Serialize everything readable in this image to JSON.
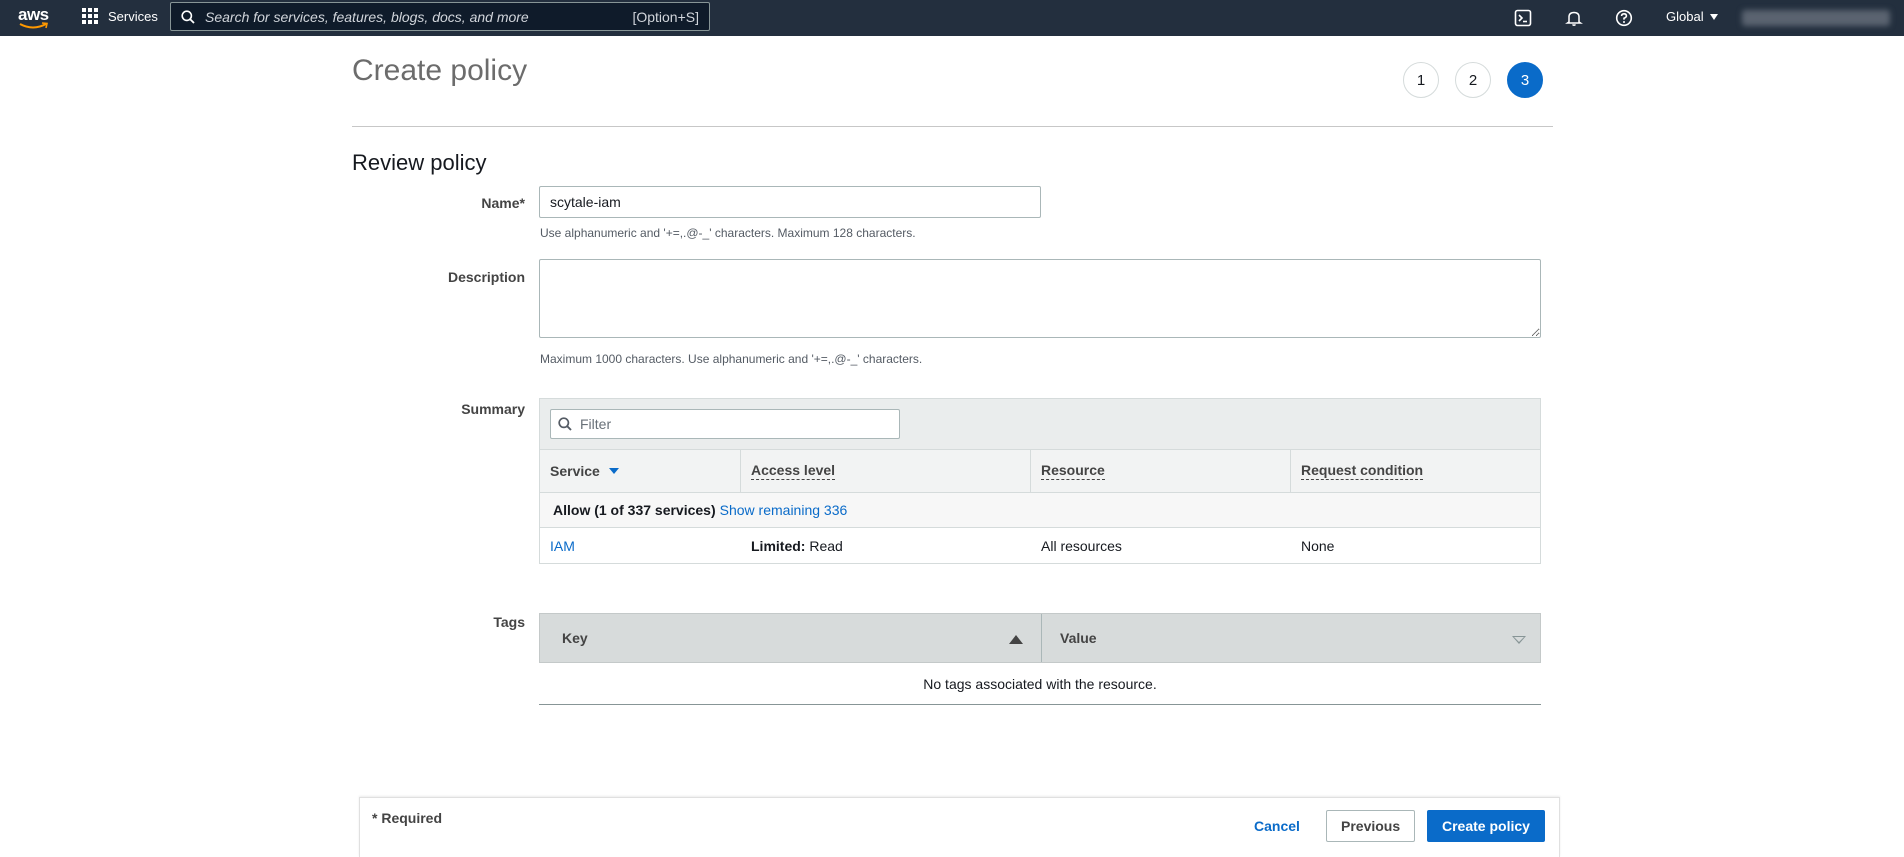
{
  "nav": {
    "logo": "aws",
    "services_label": "Services",
    "search_placeholder": "Search for services, features, blogs, docs, and more",
    "search_shortcut": "[Option+S]",
    "region": "Global",
    "icons": [
      "cloudshell-icon",
      "bell-icon",
      "help-icon"
    ]
  },
  "page": {
    "title": "Create policy",
    "steps": [
      "1",
      "2",
      "3"
    ],
    "active_step": "3",
    "section_title": "Review policy"
  },
  "form": {
    "name_label": "Name*",
    "name_value": "scytale-iam",
    "name_hint": "Use alphanumeric and '+=,.@-_' characters. Maximum 128 characters.",
    "description_label": "Description",
    "description_value": "",
    "description_hint": "Maximum 1000 characters. Use alphanumeric and '+=,.@-_' characters.",
    "summary_label": "Summary",
    "tags_label": "Tags"
  },
  "summary": {
    "filter_placeholder": "Filter",
    "columns": [
      "Service",
      "Access level",
      "Resource",
      "Request condition"
    ],
    "group_label": "Allow (1 of 337 services)",
    "group_link": "Show remaining 336",
    "rows": [
      {
        "service": "IAM",
        "access_prefix": "Limited:",
        "access_value": " Read",
        "resource": "All resources",
        "condition": "None"
      }
    ]
  },
  "tags": {
    "columns": [
      "Key",
      "Value"
    ],
    "empty": "No tags associated with the resource."
  },
  "footer": {
    "required": "* Required",
    "cancel": "Cancel",
    "previous": "Previous",
    "create": "Create policy"
  },
  "colors": {
    "nav_bg": "#232f3e",
    "accent": "#0a6bc9"
  }
}
